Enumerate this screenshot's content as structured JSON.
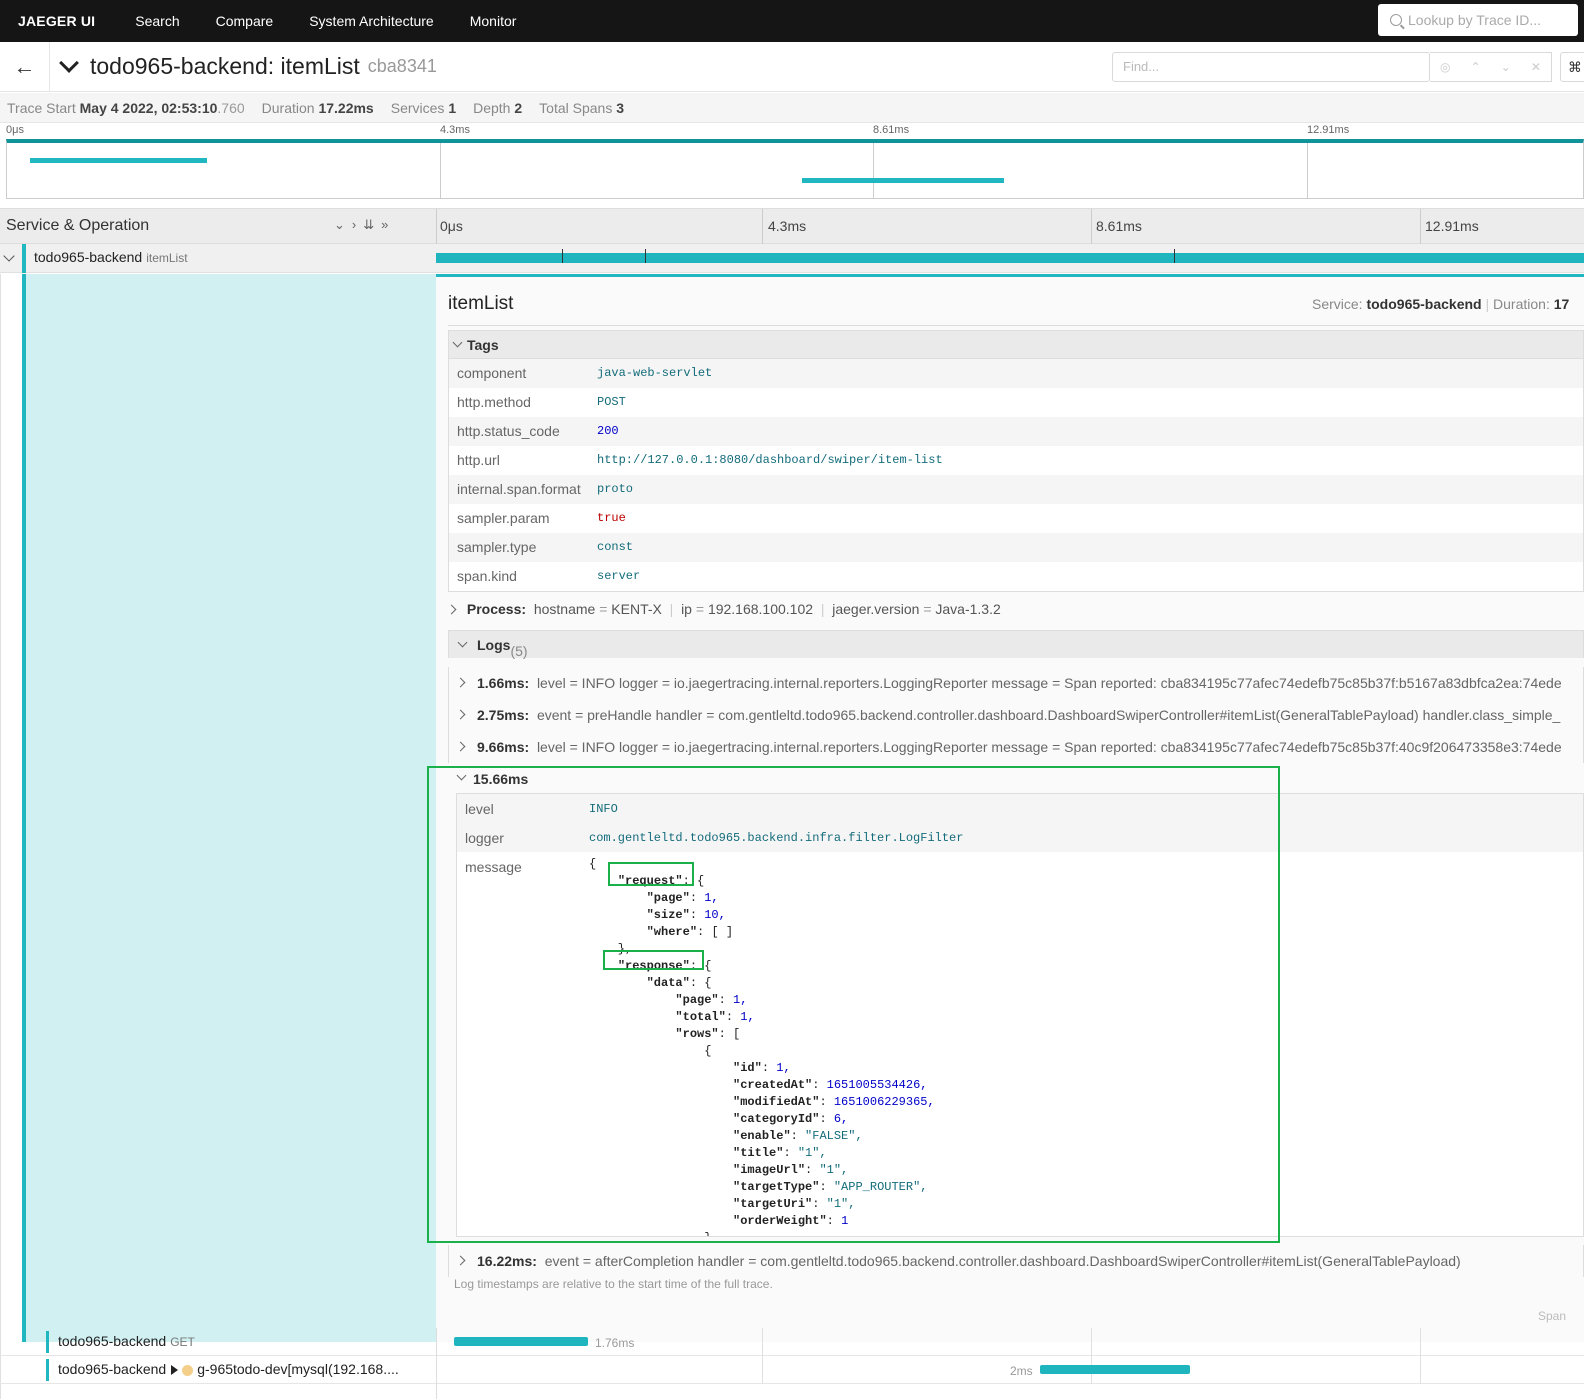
{
  "nav": {
    "brand": "JAEGER UI",
    "links": [
      "Search",
      "Compare",
      "System Architecture",
      "Monitor"
    ],
    "lookup_placeholder": "Lookup by Trace ID..."
  },
  "trace": {
    "title": "todo965-backend: itemList",
    "id": "cba8341",
    "find_placeholder": "Find..."
  },
  "summary": {
    "trace_start_label": "Trace Start",
    "trace_start_value": "May 4 2022, 02:53:10",
    "trace_start_ms": ".760",
    "duration_label": "Duration",
    "duration_value": "17.22ms",
    "services_label": "Services",
    "services_value": "1",
    "depth_label": "Depth",
    "depth_value": "2",
    "total_spans_label": "Total Spans",
    "total_spans_value": "3"
  },
  "ticks": [
    "0μs",
    "4.3ms",
    "8.61ms",
    "12.91ms"
  ],
  "timeline_header": {
    "title": "Service & Operation"
  },
  "span": {
    "service": "todo965-backend",
    "operation": "itemList",
    "detail_title": "itemList",
    "service_label": "Service:",
    "service_value": "todo965-backend",
    "duration_label": "Duration:",
    "duration_value": "17"
  },
  "tags": {
    "title": "Tags",
    "rows": [
      {
        "key": "component",
        "value": "java-web-servlet"
      },
      {
        "key": "http.method",
        "value": "POST"
      },
      {
        "key": "http.status_code",
        "value": "200"
      },
      {
        "key": "http.url",
        "value": "http://127.0.0.1:8080/dashboard/swiper/item-list"
      },
      {
        "key": "internal.span.format",
        "value": "proto"
      },
      {
        "key": "sampler.param",
        "value": "true"
      },
      {
        "key": "sampler.type",
        "value": "const"
      },
      {
        "key": "span.kind",
        "value": "server"
      }
    ]
  },
  "process": {
    "label": "Process:",
    "hostname_key": "hostname",
    "hostname_val": "KENT-X",
    "ip_key": "ip",
    "ip_val": "192.168.100.102",
    "ver_key": "jaeger.version",
    "ver_val": "Java-1.3.2"
  },
  "logs": {
    "title": "Logs",
    "count": "(5)",
    "entries": [
      {
        "time": "1.66ms:",
        "text": "level = INFO     logger = io.jaegertracing.internal.reporters.LoggingReporter     message = Span reported: cba834195c77afec74edefb75c85b37f:b5167a83dbfca2ea:74ede"
      },
      {
        "time": "2.75ms:",
        "text": "event = preHandle     handler = com.gentleltd.todo965.backend.controller.dashboard.DashboardSwiperController#itemList(GeneralTablePayload)     handler.class_simple_"
      },
      {
        "time": "9.66ms:",
        "text": "level = INFO     logger = io.jaegertracing.internal.reporters.LoggingReporter     message = Span reported: cba834195c77afec74edefb75c85b37f:40c9f206473358e3:74ede"
      }
    ],
    "expanded": {
      "time": "15.66ms",
      "level_key": "level",
      "level_val": "INFO",
      "logger_key": "logger",
      "logger_val": "com.gentleltd.todo965.backend.infra.filter.LogFilter",
      "message_key": "message"
    },
    "last": {
      "time": "16.22ms:",
      "text": "event = afterCompletion     handler = com.gentleltd.todo965.backend.controller.dashboard.DashboardSwiperController#itemList(GeneralTablePayload)"
    },
    "footnote": "Log timestamps are relative to the start time of the full trace.",
    "span_id_label": "Span"
  },
  "message_json": {
    "request_key": "\"request\"",
    "page_key": "\"page\"",
    "page_val": "1,",
    "size_key": "\"size\"",
    "size_val": "10,",
    "where_key": "\"where\"",
    "where_val": "[ ]",
    "response_key": "\"response\"",
    "data_key": "\"data\"",
    "rpage_key": "\"page\"",
    "rpage_val": "1,",
    "total_key": "\"total\"",
    "total_val": "1,",
    "rows_key": "\"rows\"",
    "id_key": "\"id\"",
    "id_val": "1,",
    "createdAt_key": "\"createdAt\"",
    "createdAt_val": "1651005534426,",
    "modifiedAt_key": "\"modifiedAt\"",
    "modifiedAt_val": "1651006229365,",
    "categoryId_key": "\"categoryId\"",
    "categoryId_val": "6,",
    "enable_key": "\"enable\"",
    "enable_val": "\"FALSE\",",
    "title_key": "\"title\"",
    "title_val": "\"1\",",
    "imageUrl_key": "\"imageUrl\"",
    "imageUrl_val": "\"1\",",
    "targetType_key": "\"targetType\"",
    "targetType_val": "\"APP_ROUTER\",",
    "targetUri_key": "\"targetUri\"",
    "targetUri_val": "\"1\",",
    "orderWeight_key": "\"orderWeight\"",
    "orderWeight_val": "1"
  },
  "child_spans": [
    {
      "service": "todo965-backend",
      "operation": "GET",
      "duration": "1.76ms"
    },
    {
      "service": "todo965-backend",
      "operation": "g-965todo-dev[mysql(192.168....",
      "duration": "2ms"
    }
  ],
  "colors": {
    "accent": "#20b7c1",
    "highlight": "#1bb14a",
    "nav_bg": "#151515"
  }
}
